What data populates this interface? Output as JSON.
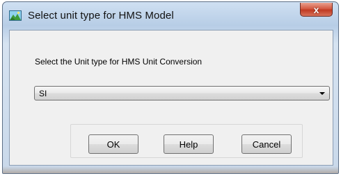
{
  "window": {
    "title": "Select unit type for HMS Model",
    "close_label": "x"
  },
  "dialog": {
    "prompt": "Select the Unit type for HMS Unit Conversion",
    "unit_select": {
      "selected": "SI"
    }
  },
  "buttons": {
    "ok": "OK",
    "help": "Help",
    "cancel": "Cancel"
  },
  "icons": {
    "app": "landscape-map-icon",
    "dropdown": "chevron-down-icon"
  },
  "colors": {
    "close_button": "#c9452e",
    "title_bar": "#b7cde6",
    "client_area": "#f0f0f0"
  }
}
